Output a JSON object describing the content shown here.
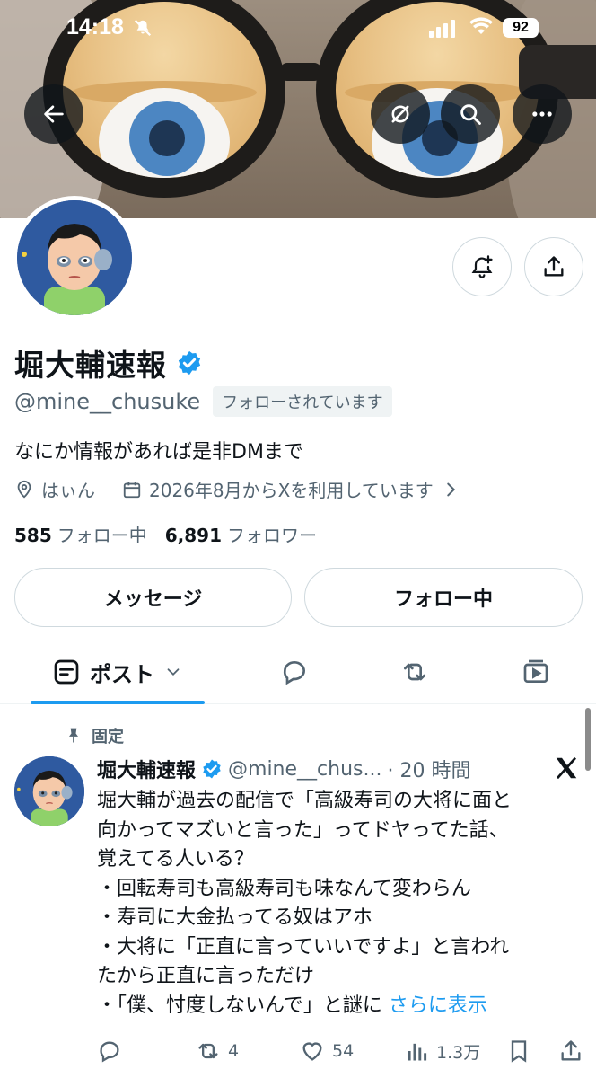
{
  "status_bar": {
    "time": "14:18",
    "battery": "92"
  },
  "profile": {
    "name": "堀大輔速報",
    "handle": "@mine__chusuke",
    "follows_you": "フォローされています",
    "bio": "なにか情報があれば是非DMまで",
    "location": "はぃん",
    "joined": "2026年8月からXを利用しています",
    "following_count": "585",
    "following_label": "フォロー中",
    "followers_count": "6,891",
    "followers_label": "フォロワー"
  },
  "buttons": {
    "message": "メッセージ",
    "following": "フォロー中"
  },
  "tabs": {
    "posts": "ポスト"
  },
  "pinned_post": {
    "pinned_label": "固定",
    "name": "堀大輔速報",
    "handle": "@mine__chus...",
    "time": "· 20 時間",
    "text": "堀大輔が過去の配信で「高級寿司の大将に面と\n向かってマズいと言った」ってドヤってた話、\n覚えてる人いる？\n・回転寿司も高級寿司も味なんて変わらん\n・寿司に大金払ってる奴はアホ\n・大将に「正直に言っていいですよ」と言われ\nたから正直に言っただけ\n・「僕、忖度しないんで」と謎に ",
    "more": "さらに表示",
    "retweets": "4",
    "likes": "54",
    "views": "1.3万"
  },
  "colors": {
    "accent": "#1d9bf0",
    "verified": "#1d9bf0",
    "muted": "#536471"
  }
}
